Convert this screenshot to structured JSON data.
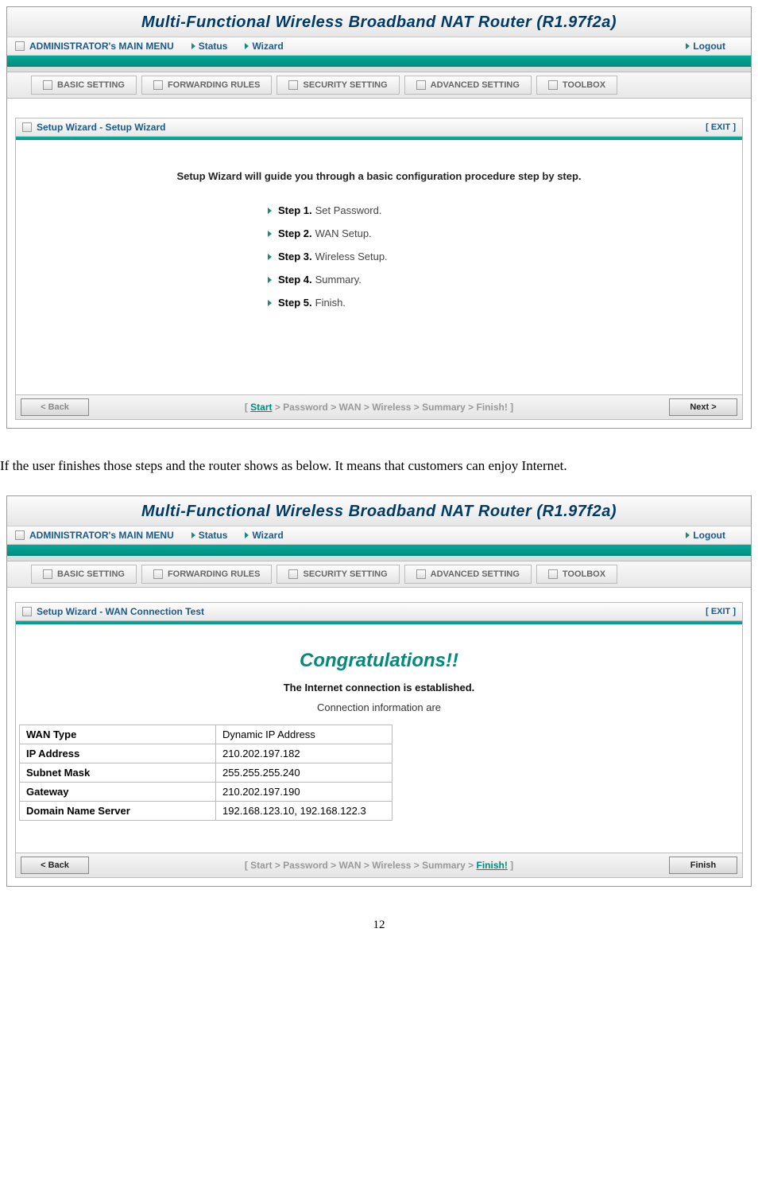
{
  "page_number": "12",
  "body_paragraph": "If the user finishes those steps and the router shows as below. It means that customers can enjoy Internet.",
  "router_title": "Multi-Functional Wireless Broadband NAT Router (R1.97f2a)",
  "admin": {
    "main": "ADMINISTRATOR's MAIN MENU",
    "status": "Status",
    "wizard": "Wizard",
    "logout": "Logout"
  },
  "tabs": {
    "basic": "BASIC SETTING",
    "forwarding": "FORWARDING RULES",
    "security": "SECURITY SETTING",
    "advanced": "ADVANCED SETTING",
    "toolbox": "TOOLBOX"
  },
  "screen1": {
    "panel_title": "Setup Wizard - Setup Wizard",
    "exit": "[ EXIT ]",
    "intro": "Setup Wizard will guide you through a basic configuration procedure step by step.",
    "steps": [
      {
        "label": "Step 1.",
        "text": "Set Password."
      },
      {
        "label": "Step 2.",
        "text": "WAN Setup."
      },
      {
        "label": "Step 3.",
        "text": "Wireless Setup."
      },
      {
        "label": "Step 4.",
        "text": "Summary."
      },
      {
        "label": "Step 5.",
        "text": "Finish."
      }
    ],
    "back": "< Back",
    "next": "Next >",
    "crumb_prefix": "[ ",
    "crumb_active": "Start",
    "crumb_rest": " > Password > WAN > Wireless > Summary > Finish! ]"
  },
  "screen2": {
    "panel_title": "Setup Wizard - WAN Connection Test",
    "exit": "[ EXIT ]",
    "congrats": "Congratulations!!",
    "established": "The Internet connection is established.",
    "info_line": "Connection information are",
    "rows": [
      {
        "k": "WAN Type",
        "v": "Dynamic IP Address"
      },
      {
        "k": "IP Address",
        "v": "210.202.197.182"
      },
      {
        "k": "Subnet Mask",
        "v": "255.255.255.240"
      },
      {
        "k": "Gateway",
        "v": "210.202.197.190"
      },
      {
        "k": "Domain Name Server",
        "v": "192.168.123.10, 192.168.122.3"
      }
    ],
    "back": "< Back",
    "finish": "Finish",
    "crumb_prefix": "[ Start > Password > WAN > Wireless > Summary > ",
    "crumb_active": "Finish!",
    "crumb_suffix": " ]"
  }
}
